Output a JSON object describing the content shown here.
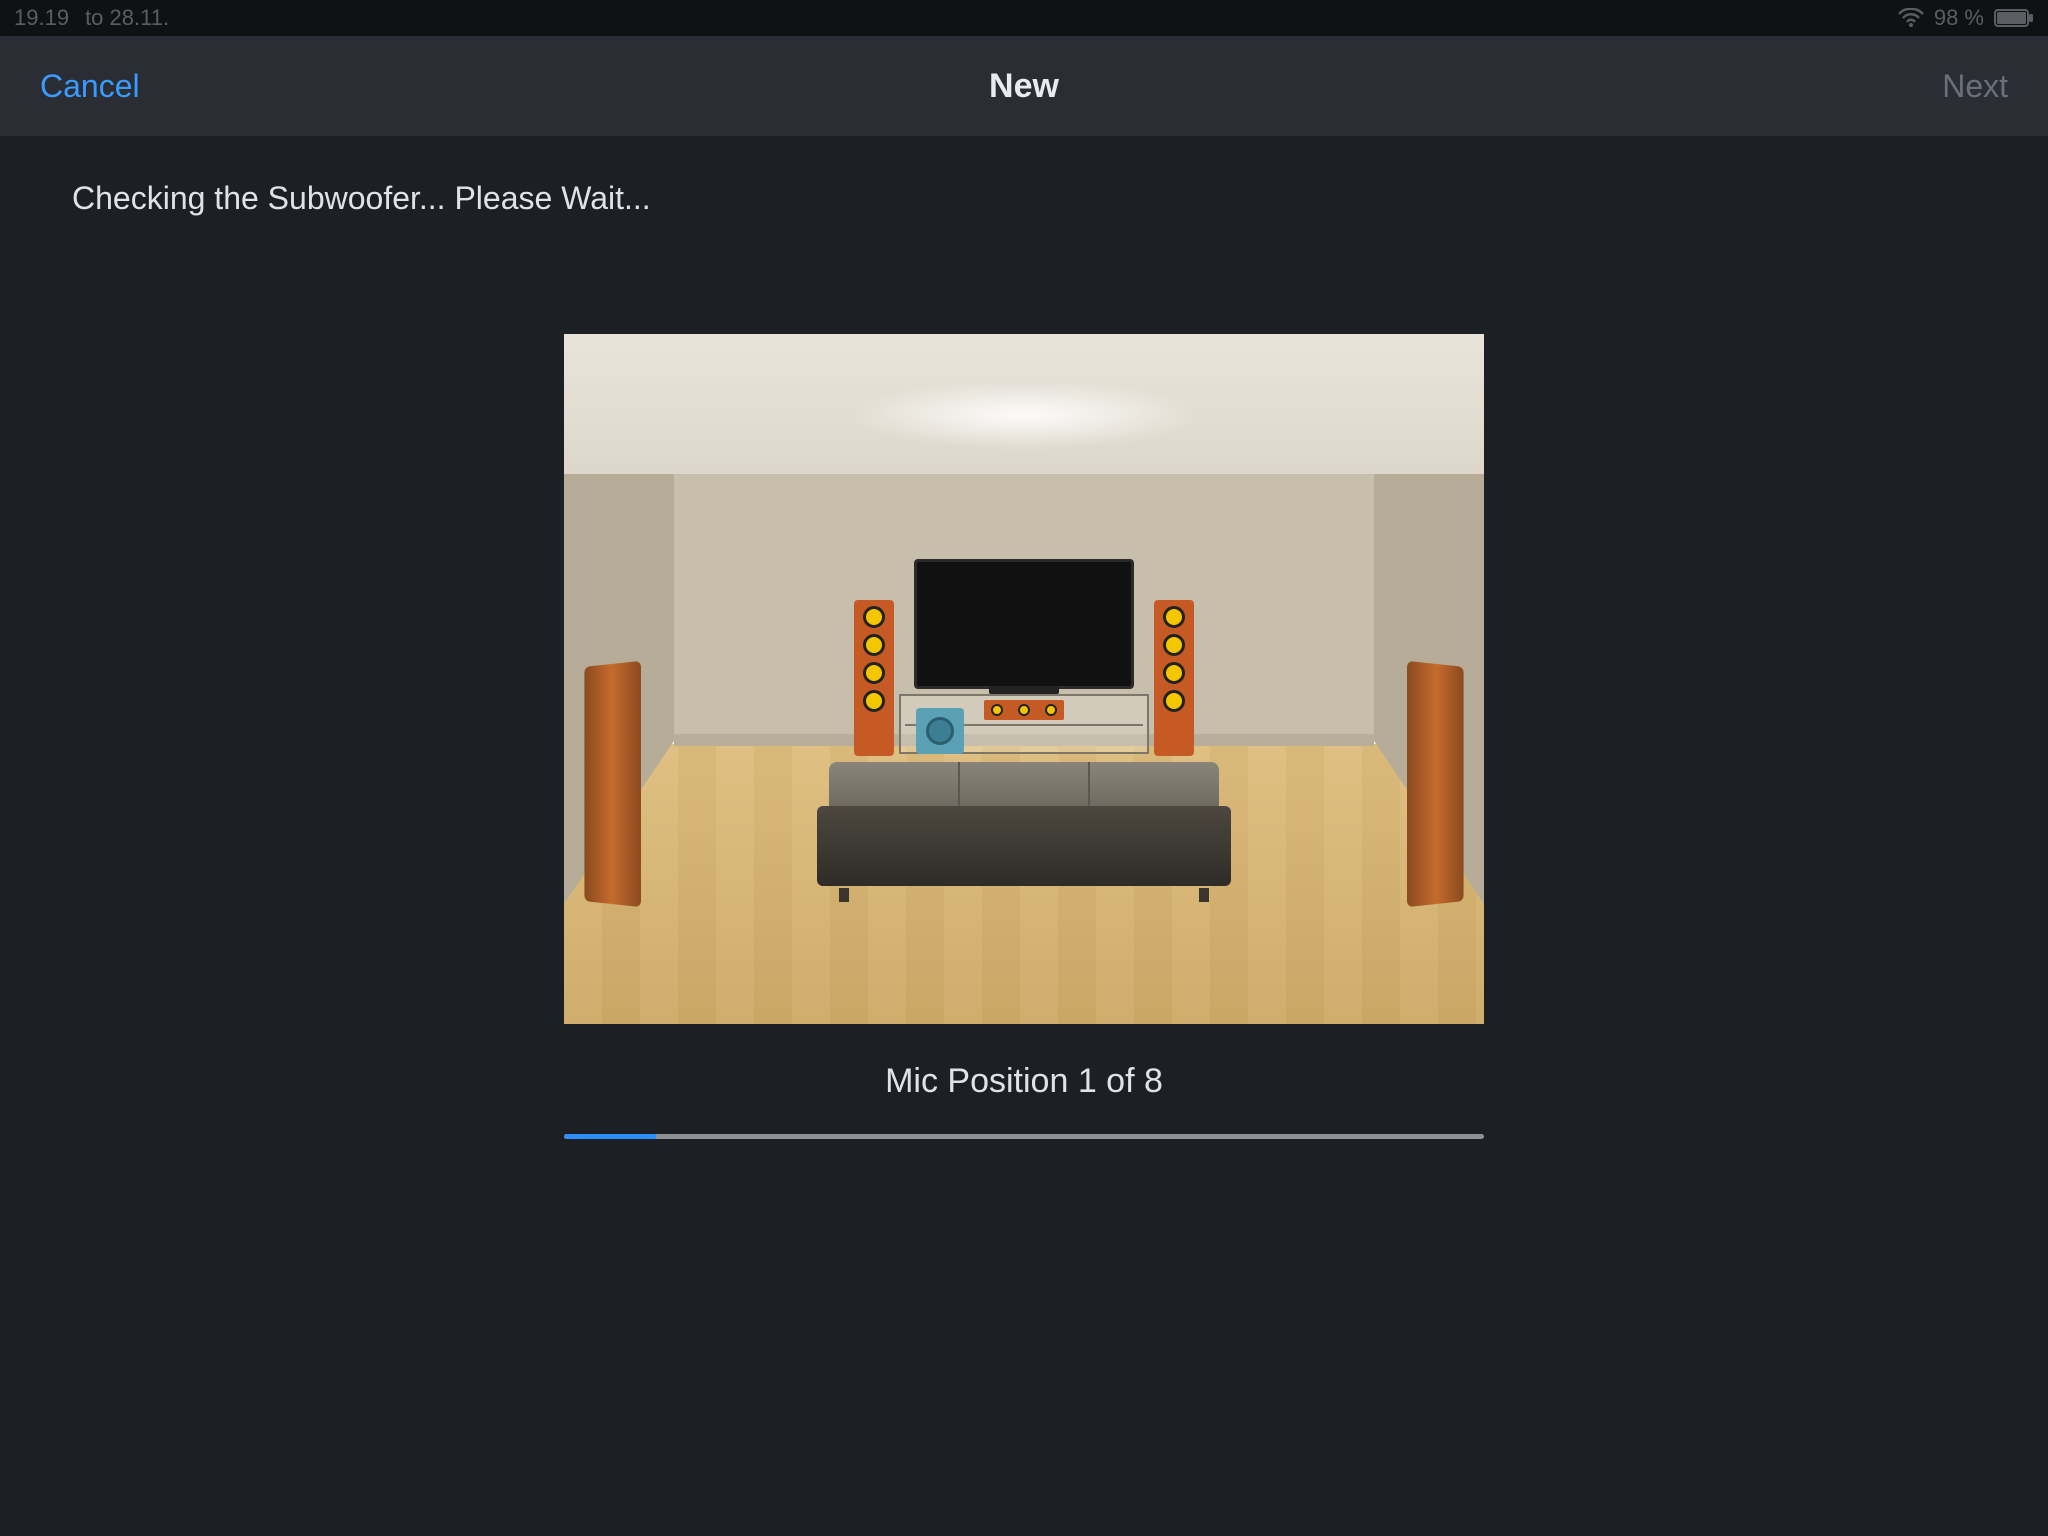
{
  "statusbar": {
    "time": "19.19",
    "date": "to 28.11.",
    "battery_text": "98 %"
  },
  "navbar": {
    "cancel": "Cancel",
    "title": "New",
    "next": "Next"
  },
  "body": {
    "status_text": "Checking the Subwoofer... Please Wait...",
    "mic_label": "Mic Position 1 of 8",
    "progress_percent": 10
  }
}
